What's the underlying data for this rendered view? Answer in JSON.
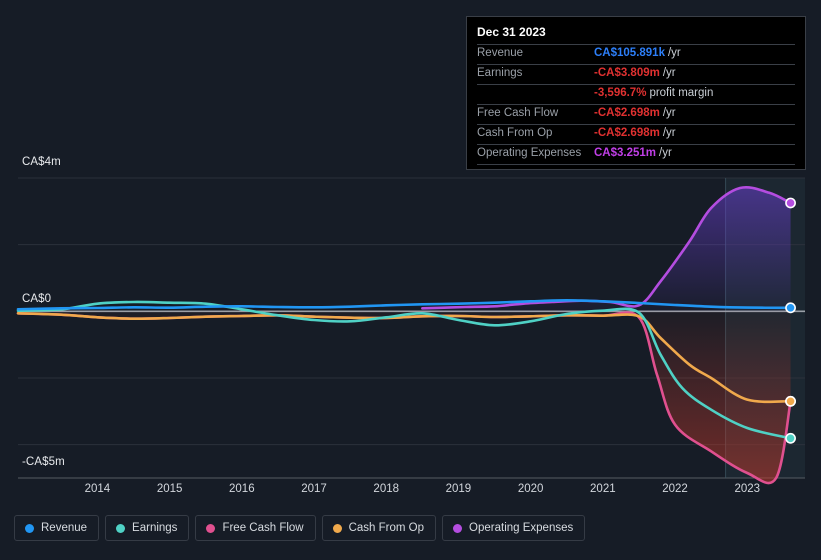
{
  "chart_data": {
    "type": "line",
    "title": "",
    "xlabel": "",
    "ylabel": "",
    "currency": "CA$",
    "ylim": [
      -5000000,
      4000000
    ],
    "xlim": [
      2013.4,
      2024.3
    ],
    "grid": true,
    "zero_line": 0,
    "y_ticks": [
      {
        "value": 4000000,
        "label": "CA$4m"
      },
      {
        "value": 2000000,
        "label": ""
      },
      {
        "value": 0,
        "label": "CA$0"
      },
      {
        "value": -2000000,
        "label": ""
      },
      {
        "value": -4000000,
        "label": ""
      },
      {
        "value": -5000000,
        "label": "-CA$5m"
      }
    ],
    "y_tick_labels": [
      "CA$4m",
      "CA$0",
      "-CA$5m"
    ],
    "x_ticks": [
      "2014",
      "2015",
      "2016",
      "2017",
      "2018",
      "2019",
      "2020",
      "2021",
      "2022",
      "2023"
    ],
    "forecast_start": 2023.2,
    "legend_position": "bottom",
    "series": [
      {
        "name": "Revenue",
        "color": "#2196f3",
        "x": [
          2013.4,
          2014,
          2014.5,
          2015,
          2015.5,
          2016,
          2016.5,
          2017,
          2017.5,
          2018,
          2018.5,
          2019,
          2019.5,
          2020,
          2020.5,
          2021,
          2021.5,
          2022,
          2022.5,
          2023,
          2023.5,
          2024.1
        ],
        "values": [
          60000,
          90000,
          100000,
          120000,
          110000,
          140000,
          150000,
          130000,
          120000,
          140000,
          180000,
          210000,
          230000,
          260000,
          300000,
          330000,
          300000,
          250000,
          190000,
          140000,
          112000,
          105891
        ],
        "end_value": 105891,
        "end_label": "CA$105.891k"
      },
      {
        "name": "Earnings",
        "color": "#4fd1c5",
        "x": [
          2013.4,
          2014,
          2014.5,
          2015,
          2015.5,
          2016,
          2016.5,
          2017,
          2017.5,
          2018,
          2018.5,
          2019,
          2019.5,
          2020,
          2020.5,
          2021,
          2021.5,
          2022,
          2022.3,
          2022.6,
          2023,
          2023.5,
          2024.1
        ],
        "values": [
          20000,
          60000,
          230000,
          280000,
          260000,
          230000,
          60000,
          -120000,
          -260000,
          -300000,
          -180000,
          -60000,
          -260000,
          -420000,
          -300000,
          -80000,
          20000,
          -40000,
          -1300000,
          -2300000,
          -2950000,
          -3500000,
          -3809000
        ],
        "end_value": -3809000,
        "end_label": "-CA$3.809m"
      },
      {
        "name": "Free Cash Flow",
        "color": "#e0508f",
        "x": [
          2013.4,
          2014,
          2014.5,
          2015,
          2015.5,
          2016,
          2016.5,
          2017,
          2017.5,
          2018,
          2018.5,
          2019,
          2019.5,
          2020,
          2020.5,
          2021,
          2021.5,
          2022,
          2022.25,
          2022.5,
          2023,
          2023.5,
          2023.9,
          2024.1
        ],
        "values": [
          -60000,
          -100000,
          -180000,
          -220000,
          -200000,
          -160000,
          -140000,
          -120000,
          -160000,
          -190000,
          -200000,
          -150000,
          -140000,
          -170000,
          -150000,
          -120000,
          -130000,
          -180000,
          -1900000,
          -3400000,
          -4200000,
          -4850000,
          -5100000,
          -2698000
        ],
        "end_value": -2698000,
        "end_label": "-CA$2.698m"
      },
      {
        "name": "Cash From Op",
        "color": "#f0a94c",
        "x": [
          2013.4,
          2014,
          2014.5,
          2015,
          2015.5,
          2016,
          2016.5,
          2017,
          2017.5,
          2018,
          2018.5,
          2019,
          2019.5,
          2020,
          2020.5,
          2021,
          2021.5,
          2022,
          2022.3,
          2022.7,
          2023,
          2023.5,
          2024.1
        ],
        "values": [
          -60000,
          -100000,
          -180000,
          -220000,
          -200000,
          -160000,
          -140000,
          -120000,
          -160000,
          -190000,
          -200000,
          -150000,
          -140000,
          -170000,
          -150000,
          -120000,
          -130000,
          -150000,
          -800000,
          -1600000,
          -2000000,
          -2650000,
          -2698000
        ],
        "end_value": -2698000,
        "end_label": "-CA$2.698m"
      },
      {
        "name": "Operating Expenses",
        "color": "#b44de0",
        "x": [
          2019,
          2019.3,
          2019.6,
          2020,
          2020.4,
          2020.8,
          2021.2,
          2021.6,
          2022,
          2022.3,
          2022.7,
          2023,
          2023.4,
          2023.8,
          2024.1
        ],
        "values": [
          90000,
          110000,
          130000,
          150000,
          230000,
          280000,
          320000,
          280000,
          180000,
          900000,
          2100000,
          3100000,
          3700000,
          3560000,
          3251000
        ],
        "end_value": 3251000,
        "end_label": "CA$3.251m"
      }
    ]
  },
  "tooltip": {
    "date": "Dec 31 2023",
    "rows": [
      {
        "label": "Revenue",
        "value": "CA$105.891k",
        "unit": "/yr",
        "color": "#2d7ff9"
      },
      {
        "label": "Earnings",
        "value": "-CA$3.809m",
        "unit": "/yr",
        "color": "#e03131"
      },
      {
        "label": "",
        "value": "-3,596.7%",
        "unit": "profit margin",
        "color": "#e03131",
        "sub": true
      },
      {
        "label": "Free Cash Flow",
        "value": "-CA$2.698m",
        "unit": "/yr",
        "color": "#e03131"
      },
      {
        "label": "Cash From Op",
        "value": "-CA$2.698m",
        "unit": "/yr",
        "color": "#e03131"
      },
      {
        "label": "Operating Expenses",
        "value": "CA$3.251m",
        "unit": "/yr",
        "color": "#c13fe8"
      }
    ]
  },
  "legend": {
    "items": [
      {
        "label": "Revenue",
        "color": "#2196f3"
      },
      {
        "label": "Earnings",
        "color": "#4fd1c5"
      },
      {
        "label": "Free Cash Flow",
        "color": "#e0508f"
      },
      {
        "label": "Cash From Op",
        "color": "#f0a94c"
      },
      {
        "label": "Operating Expenses",
        "color": "#b44de0"
      }
    ]
  },
  "colors": {
    "background": "#161c26",
    "grid": "#2b313b",
    "zero_axis": "#9aa0a8",
    "forecast_band": "rgba(60,100,115,0.16)",
    "forecast_divider": "#3d5562"
  }
}
